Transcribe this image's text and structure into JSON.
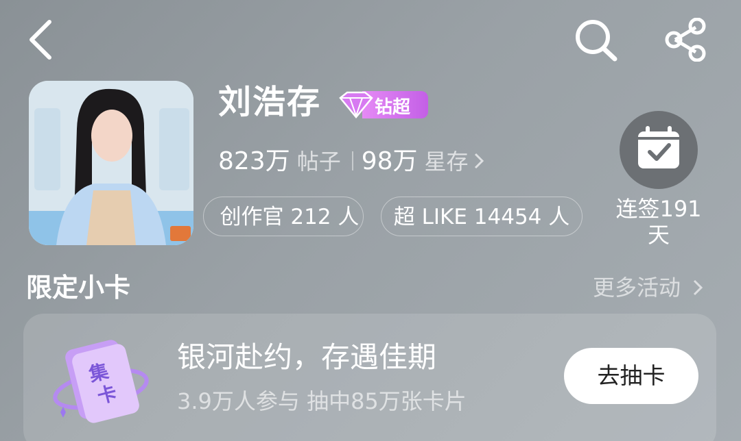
{
  "header": {
    "back_icon": "chevron-left-icon",
    "search_icon": "search-icon",
    "share_icon": "share-icon"
  },
  "profile": {
    "name": "刘浩存",
    "badge_label": "钻超",
    "badge_icon": "diamond-icon",
    "posts_count": "823万",
    "posts_label": "帖子",
    "fans_count": "98万",
    "fans_label": "星存",
    "creator_pill": "创作官 212 人",
    "like_pill": "超 LIKE 14454 人",
    "checkin_label": "连签191天",
    "checkin_icon": "calendar-check-icon"
  },
  "section": {
    "title": "限定小卡",
    "more_label": "更多活动"
  },
  "card": {
    "icon_text": "集卡",
    "title": "银河赴约，存遇佳期",
    "subtitle": "3.9万人参与 抽中85万张卡片",
    "button_label": "去抽卡"
  },
  "colors": {
    "badge_purple": "#c35fe6",
    "checkin_bg": "#6c7074",
    "button_bg": "#ffffff"
  }
}
